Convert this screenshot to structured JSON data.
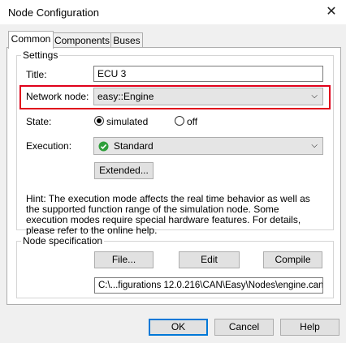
{
  "window": {
    "title": "Node Configuration",
    "close_glyph": "✕"
  },
  "tabs": [
    {
      "label": "Common",
      "active": true
    },
    {
      "label": "Components",
      "active": false
    },
    {
      "label": "Buses",
      "active": false
    }
  ],
  "settings": {
    "group_title": "Settings",
    "title_label": "Title:",
    "title_value": "ECU 3",
    "network_node_label": "Network node:",
    "network_node_value": "easy::Engine",
    "state_label": "State:",
    "state_options": [
      "simulated",
      "off"
    ],
    "state_selected": "simulated",
    "execution_label": "Execution:",
    "execution_value": "Standard",
    "execution_icon": "check-circle-icon",
    "extended_button": "Extended...",
    "hint": "Hint: The execution mode affects the real time behavior as well as the supported function range of the simulation node. Some execution modes require special hardware features. For details, please refer to the online help."
  },
  "node_spec": {
    "group_title": "Node specification",
    "file_button": "File...",
    "edit_button": "Edit",
    "compile_button": "Compile",
    "path": "C:\\...figurations 12.0.216\\CAN\\Easy\\Nodes\\engine.can"
  },
  "footer": {
    "ok": "OK",
    "cancel": "Cancel",
    "help": "Help"
  },
  "colors": {
    "highlight": "#e0001b",
    "check_green": "#2e9e3a",
    "default_button_border": "#0078d7"
  }
}
